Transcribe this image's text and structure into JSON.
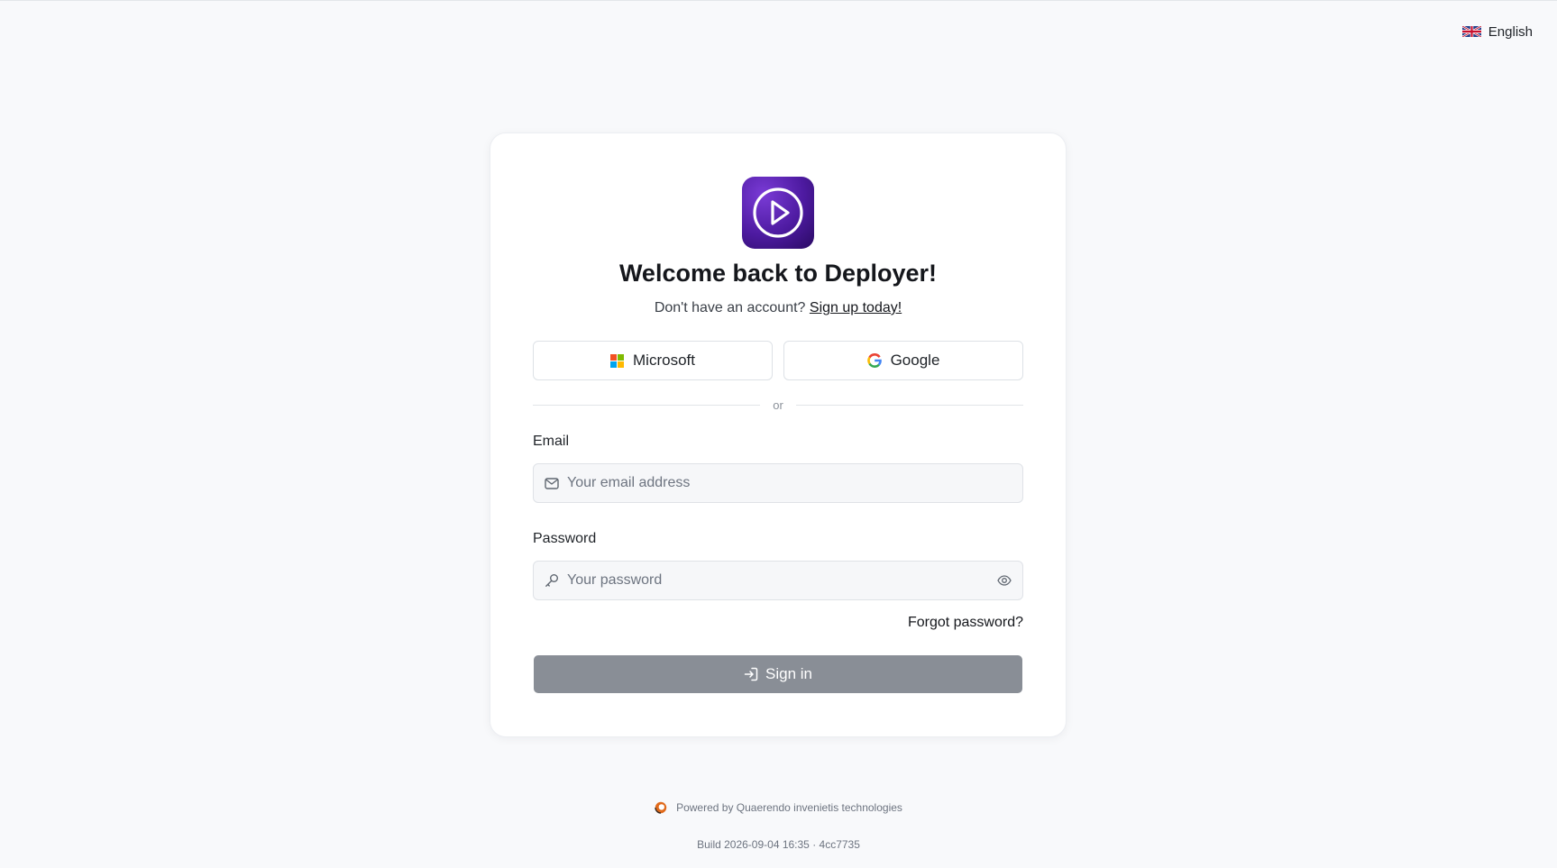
{
  "language": {
    "label": "English",
    "flag_icon": "uk-flag-icon"
  },
  "card": {
    "logo_icon": "play-circle-icon",
    "logo_colors": [
      "#7a3bd6",
      "#4d1aa0",
      "#2a0a63"
    ],
    "title": "Welcome back to Deployer!",
    "subtitle_prefix": "Don't have an account?",
    "signup_link": "Sign up today!",
    "oauth": {
      "microsoft_label": "Microsoft",
      "microsoft_icon": "microsoft-logo-icon",
      "google_label": "Google",
      "google_icon": "google-logo-icon"
    },
    "divider_text": "or",
    "email": {
      "label": "Email",
      "placeholder": "Your email address",
      "value": "",
      "icon": "mail-icon"
    },
    "password": {
      "label": "Password",
      "placeholder": "Your password",
      "value": "",
      "icon": "key-icon",
      "toggle_icon": "eye-icon"
    },
    "forgot_password": "Forgot password?",
    "signin": {
      "label": "Sign in",
      "icon": "sign-in-icon",
      "color": "#898e96"
    }
  },
  "footer": {
    "powered_by": "Powered by Quaerendo invenietis technologies",
    "powered_icon": "quaerendo-logo-icon",
    "build": "Build 2026-09-04 16:35 · 4cc7735"
  }
}
